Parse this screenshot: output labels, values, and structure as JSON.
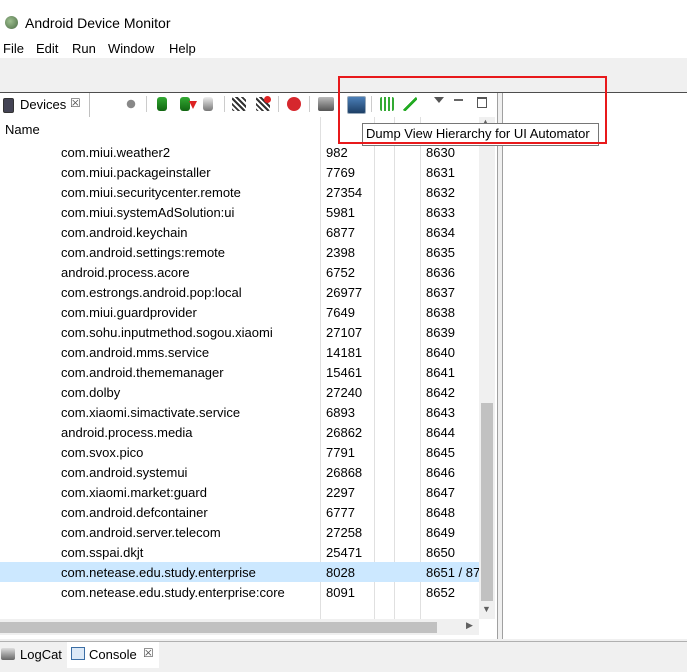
{
  "window": {
    "title": "Android Device Monitor"
  },
  "menu": [
    "File",
    "Edit",
    "Run",
    "Window",
    "Help"
  ],
  "devices_tab": {
    "label": "Devices",
    "close": "☒"
  },
  "table": {
    "header_name": "Name",
    "rows": [
      {
        "name": "com.miui.weather2",
        "pid": "982",
        "port": "8630"
      },
      {
        "name": "com.miui.packageinstaller",
        "pid": "7769",
        "port": "8631"
      },
      {
        "name": "com.miui.securitycenter.remote",
        "pid": "27354",
        "port": "8632"
      },
      {
        "name": "com.miui.systemAdSolution:ui",
        "pid": "5981",
        "port": "8633"
      },
      {
        "name": "com.android.keychain",
        "pid": "6877",
        "port": "8634"
      },
      {
        "name": "com.android.settings:remote",
        "pid": "2398",
        "port": "8635"
      },
      {
        "name": "android.process.acore",
        "pid": "6752",
        "port": "8636"
      },
      {
        "name": "com.estrongs.android.pop:local",
        "pid": "26977",
        "port": "8637"
      },
      {
        "name": "com.miui.guardprovider",
        "pid": "7649",
        "port": "8638"
      },
      {
        "name": "com.sohu.inputmethod.sogou.xiaomi",
        "pid": "27107",
        "port": "8639"
      },
      {
        "name": "com.android.mms.service",
        "pid": "14181",
        "port": "8640"
      },
      {
        "name": "com.android.thememanager",
        "pid": "15461",
        "port": "8641"
      },
      {
        "name": "com.dolby",
        "pid": "27240",
        "port": "8642"
      },
      {
        "name": "com.xiaomi.simactivate.service",
        "pid": "6893",
        "port": "8643"
      },
      {
        "name": "android.process.media",
        "pid": "26862",
        "port": "8644"
      },
      {
        "name": "com.svox.pico",
        "pid": "7791",
        "port": "8645"
      },
      {
        "name": "com.android.systemui",
        "pid": "26868",
        "port": "8646"
      },
      {
        "name": "com.xiaomi.market:guard",
        "pid": "2297",
        "port": "8647"
      },
      {
        "name": "com.android.defcontainer",
        "pid": "6777",
        "port": "8648"
      },
      {
        "name": "com.android.server.telecom",
        "pid": "27258",
        "port": "8649"
      },
      {
        "name": "com.sspai.dkjt",
        "pid": "25471",
        "port": "8650"
      },
      {
        "name": "com.netease.edu.study.enterprise",
        "pid": "8028",
        "port": "8651 / 87",
        "selected": true
      },
      {
        "name": "com.netease.edu.study.enterprise:core",
        "pid": "8091",
        "port": "8652"
      }
    ]
  },
  "tooltip": "Dump View Hierarchy for UI Automator",
  "bottom_tabs": [
    {
      "label": "LogCat"
    },
    {
      "label": "Console",
      "close": "☒"
    }
  ],
  "colors": {
    "selection": "#cce8ff",
    "highlight_box": "#e8191b"
  }
}
